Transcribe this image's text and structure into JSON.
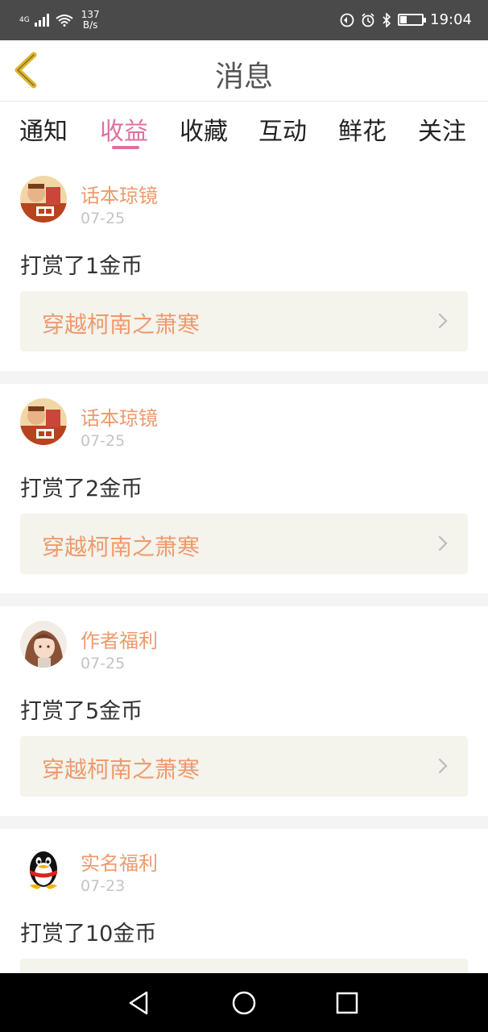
{
  "status_bar": {
    "network": "4G",
    "speed_value": "137",
    "speed_unit": "B/s",
    "time": "19:04",
    "battery_level": 0.3
  },
  "header": {
    "title": "消息"
  },
  "tabs": [
    {
      "label": "通知",
      "active": false
    },
    {
      "label": "收益",
      "active": true
    },
    {
      "label": "收藏",
      "active": false
    },
    {
      "label": "互动",
      "active": false
    },
    {
      "label": "鲜花",
      "active": false
    },
    {
      "label": "关注",
      "active": false
    }
  ],
  "messages": [
    {
      "sender": "话本琼镜",
      "date": "07-25",
      "text": "打赏了1金币",
      "book": "穿越柯南之萧寒",
      "avatar": "avatar-illustration"
    },
    {
      "sender": "话本琼镜",
      "date": "07-25",
      "text": "打赏了2金币",
      "book": "穿越柯南之萧寒",
      "avatar": "avatar-illustration"
    },
    {
      "sender": "作者福利",
      "date": "07-25",
      "text": "打赏了5金币",
      "book": "穿越柯南之萧寒",
      "avatar": "avatar-anime-girl"
    },
    {
      "sender": "实名福利",
      "date": "07-23",
      "text": "打赏了10金币",
      "book": "",
      "avatar": "avatar-qq-penguin"
    }
  ],
  "colors": {
    "accent": "#e26fa2",
    "sender": "#ee9a6d",
    "back_arrow": "#e0b62c"
  }
}
